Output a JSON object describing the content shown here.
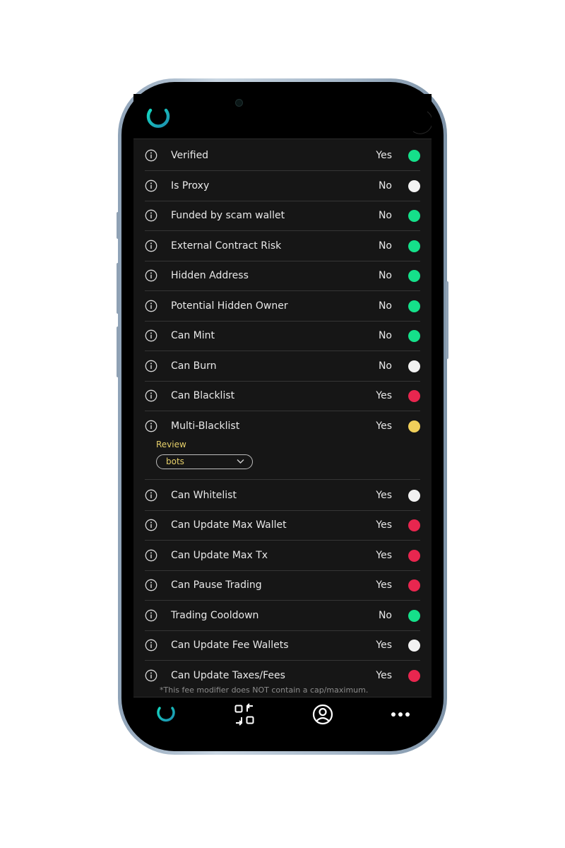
{
  "app": {
    "accent": "#12c9c9",
    "accent_dark": "#1d8fa8"
  },
  "header": {
    "logo_icon": "logo-icon",
    "theme_icon": "moon-icon"
  },
  "checks": [
    {
      "label": "Verified",
      "value": "Yes",
      "status_color": "#15e08a"
    },
    {
      "label": "Is Proxy",
      "value": "No",
      "status_color": "#f2f2f2"
    },
    {
      "label": "Funded by scam wallet",
      "value": "No",
      "status_color": "#15e08a"
    },
    {
      "label": "External Contract Risk",
      "value": "No",
      "status_color": "#15e08a"
    },
    {
      "label": "Hidden Address",
      "value": "No",
      "status_color": "#15e08a"
    },
    {
      "label": "Potential Hidden Owner",
      "value": "No",
      "status_color": "#15e08a"
    },
    {
      "label": "Can Mint",
      "value": "No",
      "status_color": "#15e08a"
    },
    {
      "label": "Can Burn",
      "value": "No",
      "status_color": "#f2f2f2"
    },
    {
      "label": "Can Blacklist",
      "value": "Yes",
      "status_color": "#e8264f"
    },
    {
      "label": "Multi-Blacklist",
      "value": "Yes",
      "status_color": "#f0cf5a"
    },
    {
      "label": "Can Whitelist",
      "value": "Yes",
      "status_color": "#f2f2f2"
    },
    {
      "label": "Can Update Max Wallet",
      "value": "Yes",
      "status_color": "#e8264f"
    },
    {
      "label": "Can Update Max Tx",
      "value": "Yes",
      "status_color": "#e8264f"
    },
    {
      "label": "Can Pause Trading",
      "value": "Yes",
      "status_color": "#e8264f"
    },
    {
      "label": "Trading Cooldown",
      "value": "No",
      "status_color": "#15e08a"
    },
    {
      "label": "Can Update Fee Wallets",
      "value": "Yes",
      "status_color": "#f2f2f2"
    },
    {
      "label": "Can Update Taxes/Fees",
      "value": "Yes",
      "status_color": "#e8264f"
    }
  ],
  "review": {
    "label": "Review",
    "selected": "bots"
  },
  "footnote": "*This fee modifier does NOT contain a cap/maximum.",
  "bottom_nav": [
    {
      "icon": "home-logo-icon"
    },
    {
      "icon": "swap-icon"
    },
    {
      "icon": "profile-icon"
    },
    {
      "icon": "more-icon"
    }
  ]
}
